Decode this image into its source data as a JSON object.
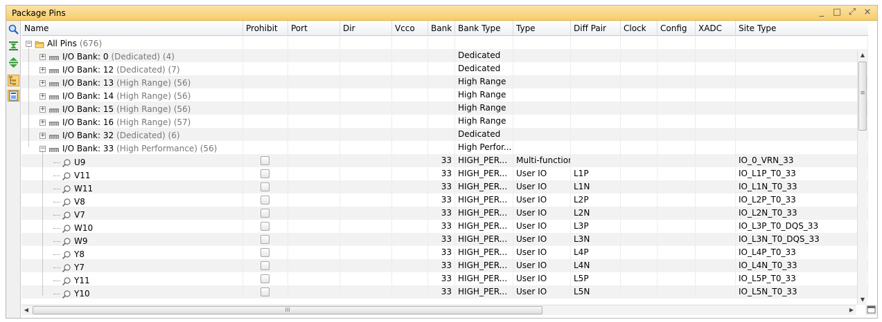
{
  "window": {
    "title": "Package Pins",
    "controls": [
      "_",
      "□",
      "⤢",
      "×"
    ]
  },
  "toolbar": {
    "icons": [
      "search-icon",
      "collapse-all-icon",
      "expand-all-icon",
      "group-by-icon",
      "export-icon"
    ]
  },
  "columns": [
    "Name",
    "Prohibit",
    "Port",
    "Dir",
    "Vcco",
    "Bank",
    "Bank Type",
    "Type",
    "Diff Pair",
    "Clock",
    "Config",
    "XADC",
    "Site Type"
  ],
  "rows": [
    {
      "level": 0,
      "kind": "root",
      "name": "All Pins",
      "extra": "(676)",
      "prohibit": false,
      "bank": "",
      "bank_type": "",
      "type": "",
      "diff": "",
      "site": ""
    },
    {
      "level": 1,
      "kind": "bank",
      "name": "I/O Bank: 0",
      "extra": "(Dedicated) (4)",
      "prohibit": false,
      "bank": "",
      "bank_type": "Dedicated",
      "type": "",
      "diff": "",
      "site": ""
    },
    {
      "level": 1,
      "kind": "bank",
      "name": "I/O Bank: 12",
      "extra": "(Dedicated) (7)",
      "prohibit": false,
      "bank": "",
      "bank_type": "Dedicated",
      "type": "",
      "diff": "",
      "site": ""
    },
    {
      "level": 1,
      "kind": "bank",
      "name": "I/O Bank: 13",
      "extra": "(High Range) (56)",
      "prohibit": false,
      "bank": "",
      "bank_type": "High Range",
      "type": "",
      "diff": "",
      "site": ""
    },
    {
      "level": 1,
      "kind": "bank",
      "name": "I/O Bank: 14",
      "extra": "(High Range) (56)",
      "prohibit": false,
      "bank": "",
      "bank_type": "High Range",
      "type": "",
      "diff": "",
      "site": ""
    },
    {
      "level": 1,
      "kind": "bank",
      "name": "I/O Bank: 15",
      "extra": "(High Range) (56)",
      "prohibit": false,
      "bank": "",
      "bank_type": "High Range",
      "type": "",
      "diff": "",
      "site": ""
    },
    {
      "level": 1,
      "kind": "bank",
      "name": "I/O Bank: 16",
      "extra": "(High Range) (57)",
      "prohibit": false,
      "bank": "",
      "bank_type": "High Range",
      "type": "",
      "diff": "",
      "site": ""
    },
    {
      "level": 1,
      "kind": "bank",
      "name": "I/O Bank: 32",
      "extra": "(Dedicated) (6)",
      "prohibit": false,
      "bank": "",
      "bank_type": "Dedicated",
      "type": "",
      "diff": "",
      "site": ""
    },
    {
      "level": 1,
      "kind": "bank-open",
      "name": "I/O Bank: 33",
      "extra": "(High Performance) (56)",
      "prohibit": false,
      "bank": "",
      "bank_type": "High Perfor...",
      "type": "",
      "diff": "",
      "site": ""
    },
    {
      "level": 2,
      "kind": "pin",
      "name": "U9",
      "extra": "",
      "prohibit": true,
      "bank": "33",
      "bank_type": "HIGH_PER...",
      "type": "Multi-function",
      "diff": "",
      "site": "IO_0_VRN_33"
    },
    {
      "level": 2,
      "kind": "pin",
      "name": "V11",
      "extra": "",
      "prohibit": true,
      "bank": "33",
      "bank_type": "HIGH_PER...",
      "type": "User IO",
      "diff": "L1P",
      "site": "IO_L1P_T0_33"
    },
    {
      "level": 2,
      "kind": "pin",
      "name": "W11",
      "extra": "",
      "prohibit": true,
      "bank": "33",
      "bank_type": "HIGH_PER...",
      "type": "User IO",
      "diff": "L1N",
      "site": "IO_L1N_T0_33"
    },
    {
      "level": 2,
      "kind": "pin",
      "name": "V8",
      "extra": "",
      "prohibit": true,
      "bank": "33",
      "bank_type": "HIGH_PER...",
      "type": "User IO",
      "diff": "L2P",
      "site": "IO_L2P_T0_33"
    },
    {
      "level": 2,
      "kind": "pin",
      "name": "V7",
      "extra": "",
      "prohibit": true,
      "bank": "33",
      "bank_type": "HIGH_PER...",
      "type": "User IO",
      "diff": "L2N",
      "site": "IO_L2N_T0_33"
    },
    {
      "level": 2,
      "kind": "pin",
      "name": "W10",
      "extra": "",
      "prohibit": true,
      "bank": "33",
      "bank_type": "HIGH_PER...",
      "type": "User IO",
      "diff": "L3P",
      "site": "IO_L3P_T0_DQS_33"
    },
    {
      "level": 2,
      "kind": "pin",
      "name": "W9",
      "extra": "",
      "prohibit": true,
      "bank": "33",
      "bank_type": "HIGH_PER...",
      "type": "User IO",
      "diff": "L3N",
      "site": "IO_L3N_T0_DQS_33"
    },
    {
      "level": 2,
      "kind": "pin",
      "name": "Y8",
      "extra": "",
      "prohibit": true,
      "bank": "33",
      "bank_type": "HIGH_PER...",
      "type": "User IO",
      "diff": "L4P",
      "site": "IO_L4P_T0_33"
    },
    {
      "level": 2,
      "kind": "pin",
      "name": "Y7",
      "extra": "",
      "prohibit": true,
      "bank": "33",
      "bank_type": "HIGH_PER...",
      "type": "User IO",
      "diff": "L4N",
      "site": "IO_L4N_T0_33"
    },
    {
      "level": 2,
      "kind": "pin",
      "name": "Y11",
      "extra": "",
      "prohibit": true,
      "bank": "33",
      "bank_type": "HIGH_PER...",
      "type": "User IO",
      "diff": "L5P",
      "site": "IO_L5P_T0_33"
    },
    {
      "level": 2,
      "kind": "pin",
      "name": "Y10",
      "extra": "",
      "prohibit": true,
      "bank": "33",
      "bank_type": "HIGH_PER...",
      "type": "User IO",
      "diff": "L5N",
      "site": "IO_L5N_T0_33"
    }
  ],
  "scrollbars": {
    "up": "▲",
    "down": "▼",
    "left": "◀",
    "right": "▶",
    "grip_h": "III",
    "grip_v": "≡"
  }
}
